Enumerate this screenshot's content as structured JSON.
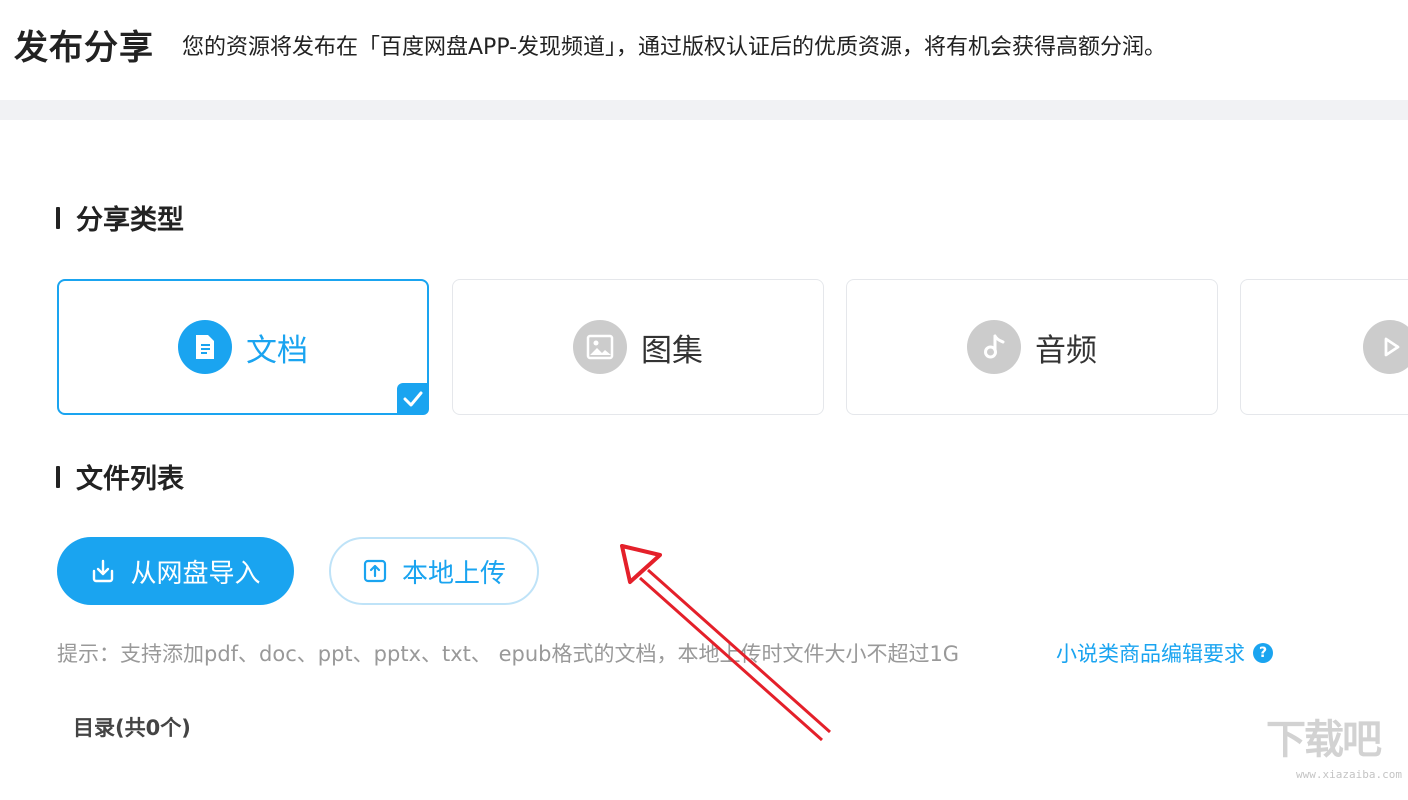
{
  "header": {
    "title": "发布分享",
    "description": "您的资源将发布在「百度网盘APP-发现频道」，通过版权认证后的优质资源，将有机会获得高额分润。"
  },
  "share_type": {
    "section_title": "分享类型",
    "types": [
      {
        "label": "文档",
        "icon": "document-icon",
        "selected": true
      },
      {
        "label": "图集",
        "icon": "image-icon",
        "selected": false
      },
      {
        "label": "音频",
        "icon": "music-note-icon",
        "selected": false
      },
      {
        "label": "",
        "icon": "play-icon",
        "selected": false
      }
    ]
  },
  "file_list": {
    "section_title": "文件列表",
    "import_button": "从网盘导入",
    "upload_button": "本地上传",
    "hint": "提示：支持添加pdf、doc、ppt、pptx、txt、 epub格式的文档，本地上传时文件大小不超过1G",
    "hint_link": "小说类商品编辑要求",
    "help_icon": "?",
    "catalog": "目录(共0个)"
  },
  "watermark": {
    "text": "下载吧",
    "url": "www.xiazaiba.com"
  },
  "colors": {
    "accent": "#1aa4f0",
    "annotation_arrow": "#e4202a",
    "inactive_icon": "#cccccc"
  }
}
